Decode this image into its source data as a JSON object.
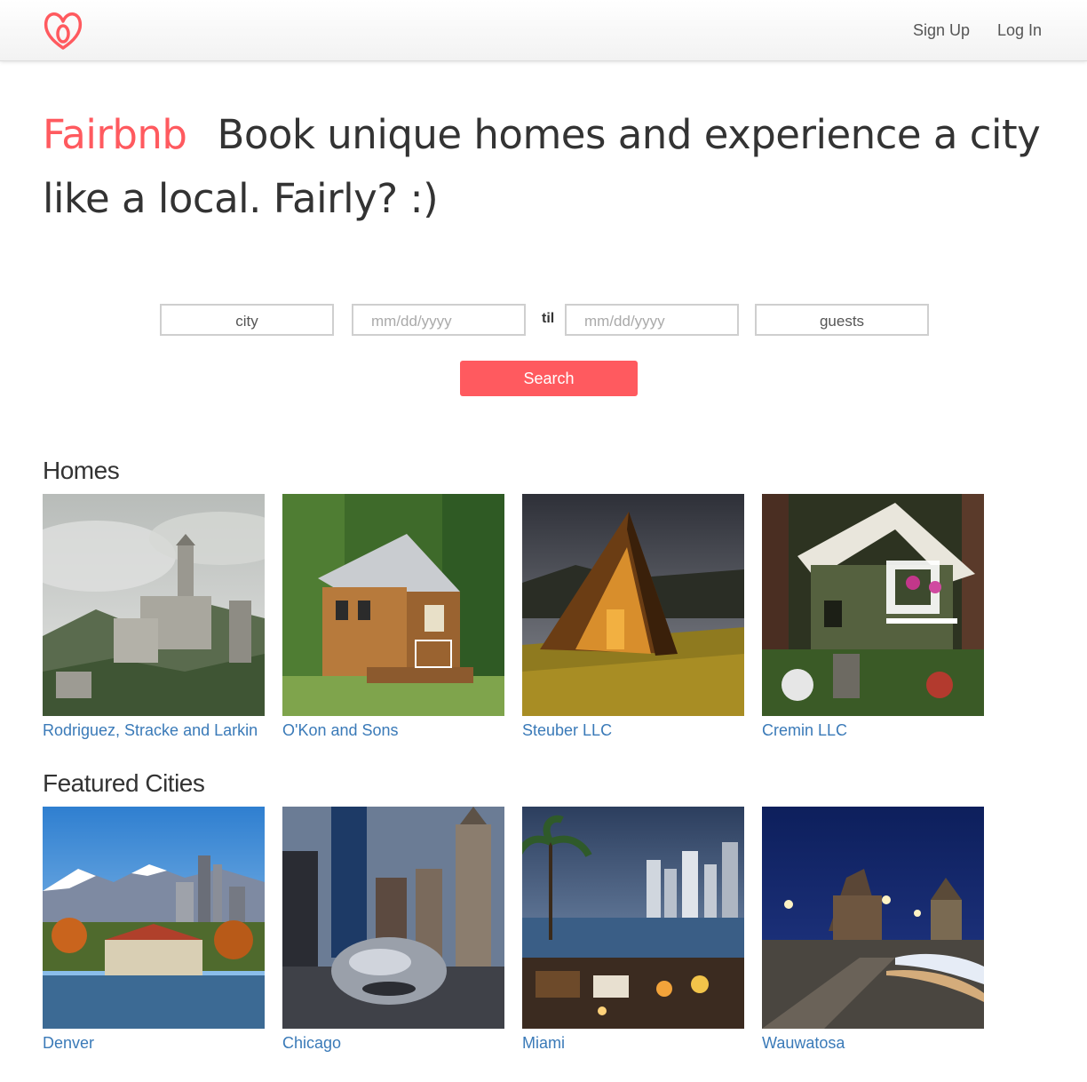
{
  "brand": {
    "name": "Fairbnb",
    "tagline": "Book unique homes and experience a city like a local. Fairly? :)",
    "accent": "#ff5a5f"
  },
  "nav": {
    "signup_label": "Sign Up",
    "login_label": "Log In"
  },
  "search": {
    "city_placeholder": "city",
    "checkin_placeholder": "mm/dd/yyyy",
    "til_label": "til",
    "checkout_placeholder": "mm/dd/yyyy",
    "guests_placeholder": "guests",
    "button_label": "Search"
  },
  "homes": {
    "title": "Homes",
    "items": [
      {
        "name": "Rodriguez, Stracke and Larkin"
      },
      {
        "name": "O'Kon and Sons"
      },
      {
        "name": "Steuber LLC"
      },
      {
        "name": "Cremin LLC"
      }
    ]
  },
  "cities": {
    "title": "Featured Cities",
    "items": [
      {
        "name": "Denver"
      },
      {
        "name": "Chicago"
      },
      {
        "name": "Miami"
      },
      {
        "name": "Wauwatosa"
      }
    ]
  },
  "colors": {
    "link": "#3a7ab8",
    "accent": "#ff5a5f"
  }
}
